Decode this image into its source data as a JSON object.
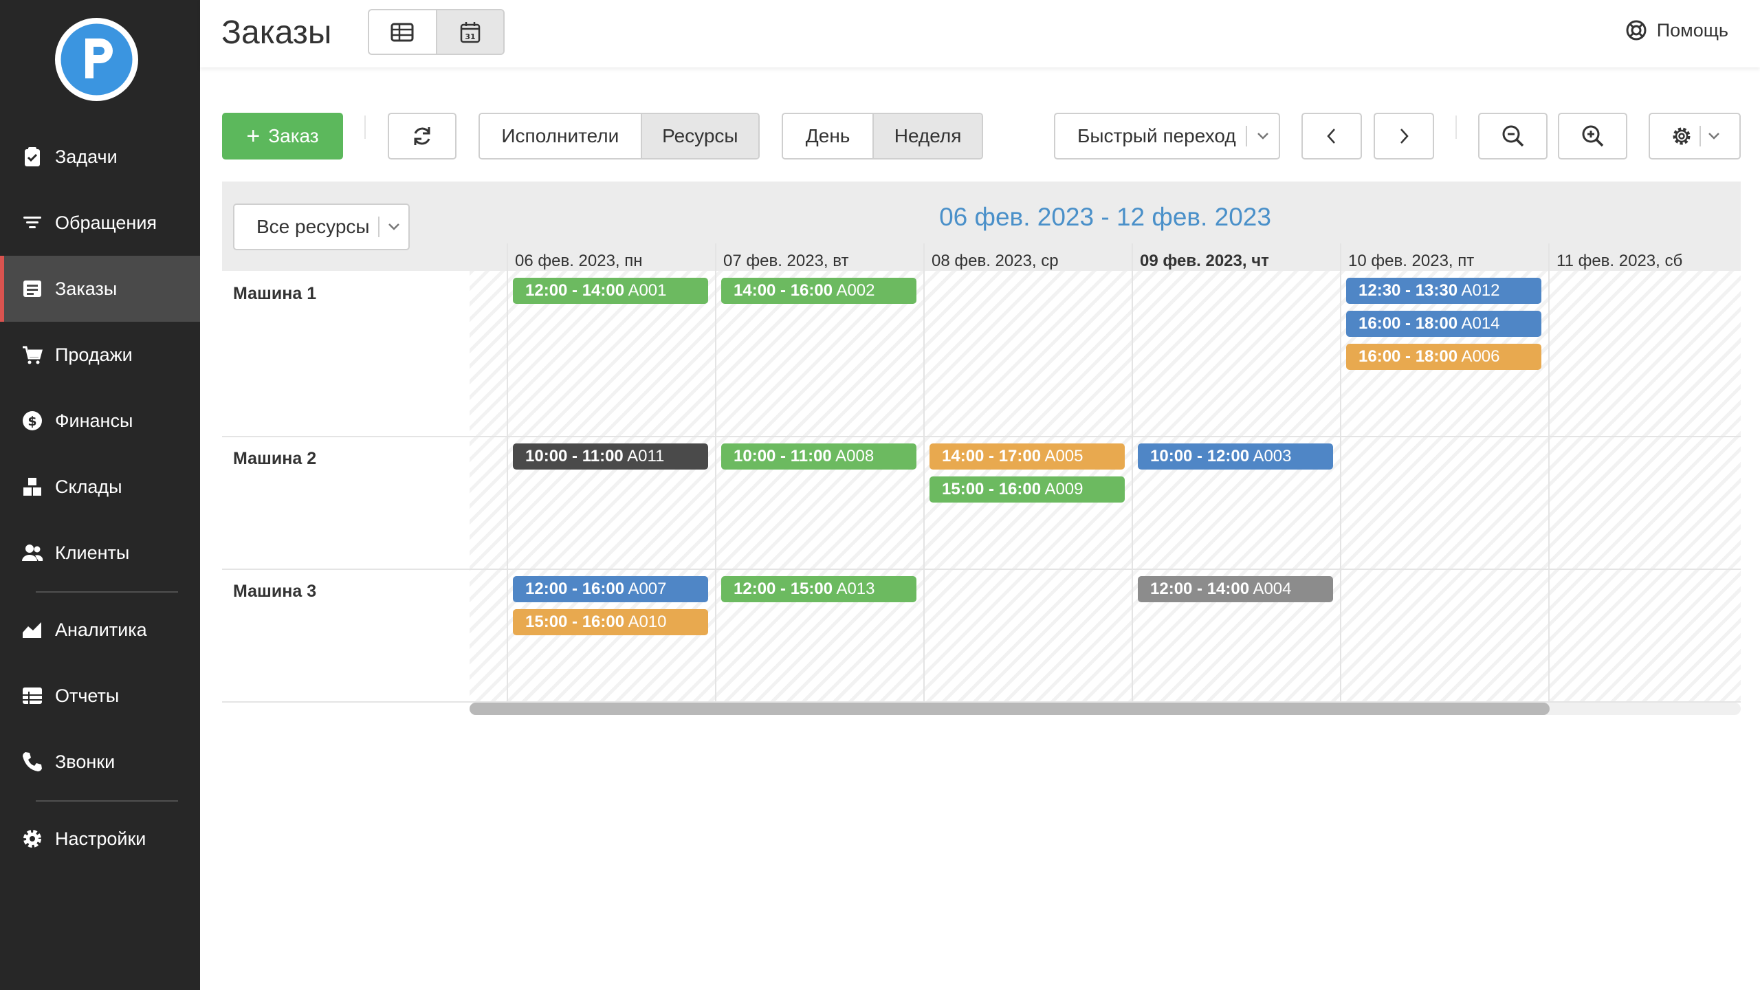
{
  "app": {
    "page_title": "Заказы",
    "help_label": "Помощь"
  },
  "sidebar": {
    "items": [
      {
        "label": "Задачи",
        "icon": "clipboard-check-icon"
      },
      {
        "label": "Обращения",
        "icon": "filter-lines-icon"
      },
      {
        "label": "Заказы",
        "icon": "order-list-icon",
        "active": true
      },
      {
        "label": "Продажи",
        "icon": "cart-icon"
      },
      {
        "label": "Финансы",
        "icon": "dollar-circle-icon"
      },
      {
        "label": "Склады",
        "icon": "boxes-icon"
      },
      {
        "label": "Клиенты",
        "icon": "users-icon"
      },
      {
        "label": "Аналитика",
        "icon": "area-chart-icon"
      },
      {
        "label": "Отчеты",
        "icon": "report-table-icon"
      },
      {
        "label": "Звонки",
        "icon": "phone-icon"
      },
      {
        "label": "Настройки",
        "icon": "gear-icon"
      }
    ]
  },
  "toolbar": {
    "add_order_label": "Заказ",
    "group_by": {
      "options": [
        "Исполнители",
        "Ресурсы"
      ],
      "selected": "Ресурсы"
    },
    "period": {
      "options": [
        "День",
        "Неделя"
      ],
      "selected": "Неделя"
    },
    "quick_jump_label": "Быстрый переход"
  },
  "scheduler": {
    "resource_filter": "Все ресурсы",
    "range_title": "06 фев. 2023 - 12 фев. 2023",
    "days": [
      "06 фев. 2023, пн",
      "07 фев. 2023, вт",
      "08 фев. 2023, ср",
      "09 фев. 2023, чт",
      "10 фев. 2023, пт",
      "11 фев. 2023, сб"
    ],
    "today_index": 3,
    "resources": [
      "Машина 1",
      "Машина 2",
      "Машина 3"
    ],
    "events": [
      {
        "resource": 0,
        "day": 0,
        "slot": 0,
        "time": "12:00 - 14:00",
        "code": "A001",
        "color": "#6cba60"
      },
      {
        "resource": 0,
        "day": 1,
        "slot": 0,
        "time": "14:00 - 16:00",
        "code": "A002",
        "color": "#6cba60"
      },
      {
        "resource": 0,
        "day": 4,
        "slot": 0,
        "time": "12:30 - 13:30",
        "code": "A012",
        "color": "#4f86c6"
      },
      {
        "resource": 0,
        "day": 4,
        "slot": 1,
        "time": "16:00 - 18:00",
        "code": "A014",
        "color": "#4f86c6"
      },
      {
        "resource": 0,
        "day": 4,
        "slot": 2,
        "time": "16:00 - 18:00",
        "code": "A006",
        "color": "#e8a94f"
      },
      {
        "resource": 1,
        "day": 0,
        "slot": 0,
        "time": "10:00 - 11:00",
        "code": "A011",
        "color": "#4a4a4a"
      },
      {
        "resource": 1,
        "day": 1,
        "slot": 0,
        "time": "10:00 - 11:00",
        "code": "A008",
        "color": "#6cba60"
      },
      {
        "resource": 1,
        "day": 2,
        "slot": 0,
        "time": "14:00 - 17:00",
        "code": "A005",
        "color": "#e8a94f"
      },
      {
        "resource": 1,
        "day": 2,
        "slot": 1,
        "time": "15:00 - 16:00",
        "code": "A009",
        "color": "#6cba60"
      },
      {
        "resource": 1,
        "day": 3,
        "slot": 0,
        "time": "10:00 - 12:00",
        "code": "A003",
        "color": "#4f86c6"
      },
      {
        "resource": 2,
        "day": 0,
        "slot": 0,
        "time": "12:00 - 16:00",
        "code": "A007",
        "color": "#4f86c6"
      },
      {
        "resource": 2,
        "day": 0,
        "slot": 1,
        "time": "15:00 - 16:00",
        "code": "A010",
        "color": "#e8a94f"
      },
      {
        "resource": 2,
        "day": 1,
        "slot": 0,
        "time": "12:00 - 15:00",
        "code": "A013",
        "color": "#6cba60"
      },
      {
        "resource": 2,
        "day": 3,
        "slot": 0,
        "time": "12:00 - 14:00",
        "code": "A004",
        "color": "#8c8c8c"
      }
    ]
  }
}
